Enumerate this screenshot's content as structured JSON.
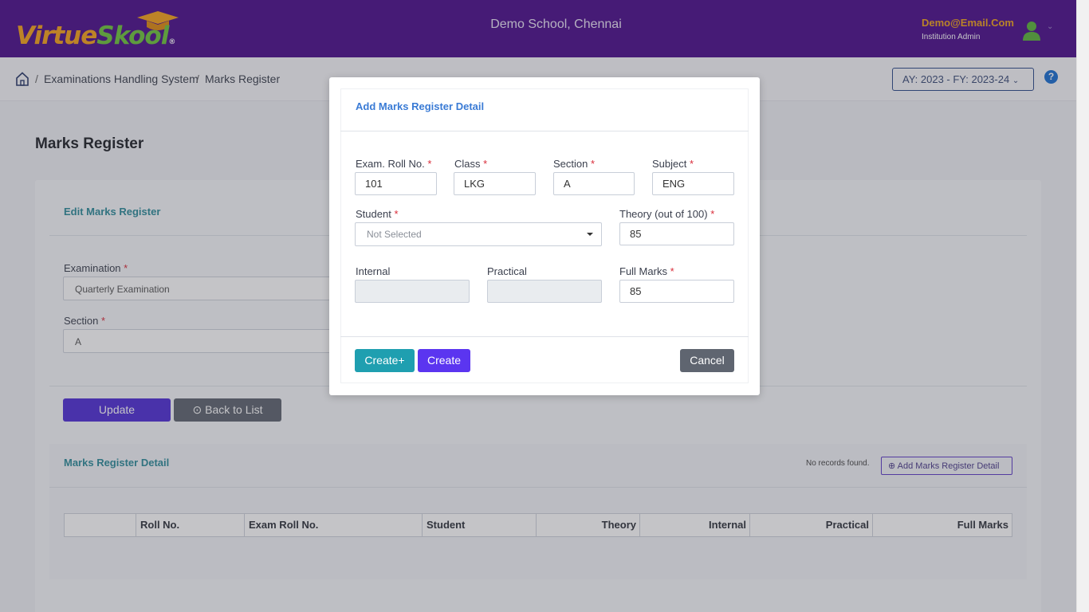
{
  "header": {
    "logo_part1": "Virtue",
    "logo_part2": "Skool",
    "logo_reg": "®",
    "school": "Demo School, Chennai",
    "user_email": "Demo@Email.Com",
    "user_role": "Institution Admin"
  },
  "breadcrumb": {
    "items": [
      "Examinations Handling System",
      "Marks Register"
    ],
    "separator": "/"
  },
  "ay_select": "AY: 2023 - FY: 2023-24",
  "help": "?",
  "page": {
    "title": "Marks Register",
    "edit_card_title": "Edit Marks Register",
    "examination_label": "Examination",
    "examination_value": "Quarterly Examination",
    "section_label": "Section",
    "section_value": "A",
    "required_mark": "*",
    "update_btn": "Update",
    "back_btn": "Back to List",
    "detail_title": "Marks Register Detail",
    "no_records": "No records found.",
    "add_detail_btn": "Add Marks Register Detail",
    "grid_columns": [
      "",
      "Roll No.",
      "Exam Roll No.",
      "Student",
      "Theory",
      "Internal",
      "Practical",
      "Full Marks"
    ]
  },
  "modal": {
    "title": "Add Marks Register Detail",
    "exam_roll_label": "Exam. Roll No.",
    "exam_roll_value": "101",
    "class_label": "Class",
    "class_value": "LKG",
    "section_label": "Section",
    "section_value": "A",
    "subject_label": "Subject",
    "subject_value": "ENG",
    "student_label": "Student",
    "student_placeholder": "Not Selected",
    "theory_label": "Theory (out of 100)",
    "theory_value": "85",
    "internal_label": "Internal",
    "practical_label": "Practical",
    "full_marks_label": "Full Marks",
    "full_marks_value": "85",
    "create_plus_btn": "Create+",
    "create_btn": "Create",
    "cancel_btn": "Cancel"
  },
  "colors": {
    "header_bg": "#4b0e8c",
    "accent_purple": "#4f2fd6",
    "teal": "#1f9fb0",
    "gray_btn": "#5f6570"
  }
}
